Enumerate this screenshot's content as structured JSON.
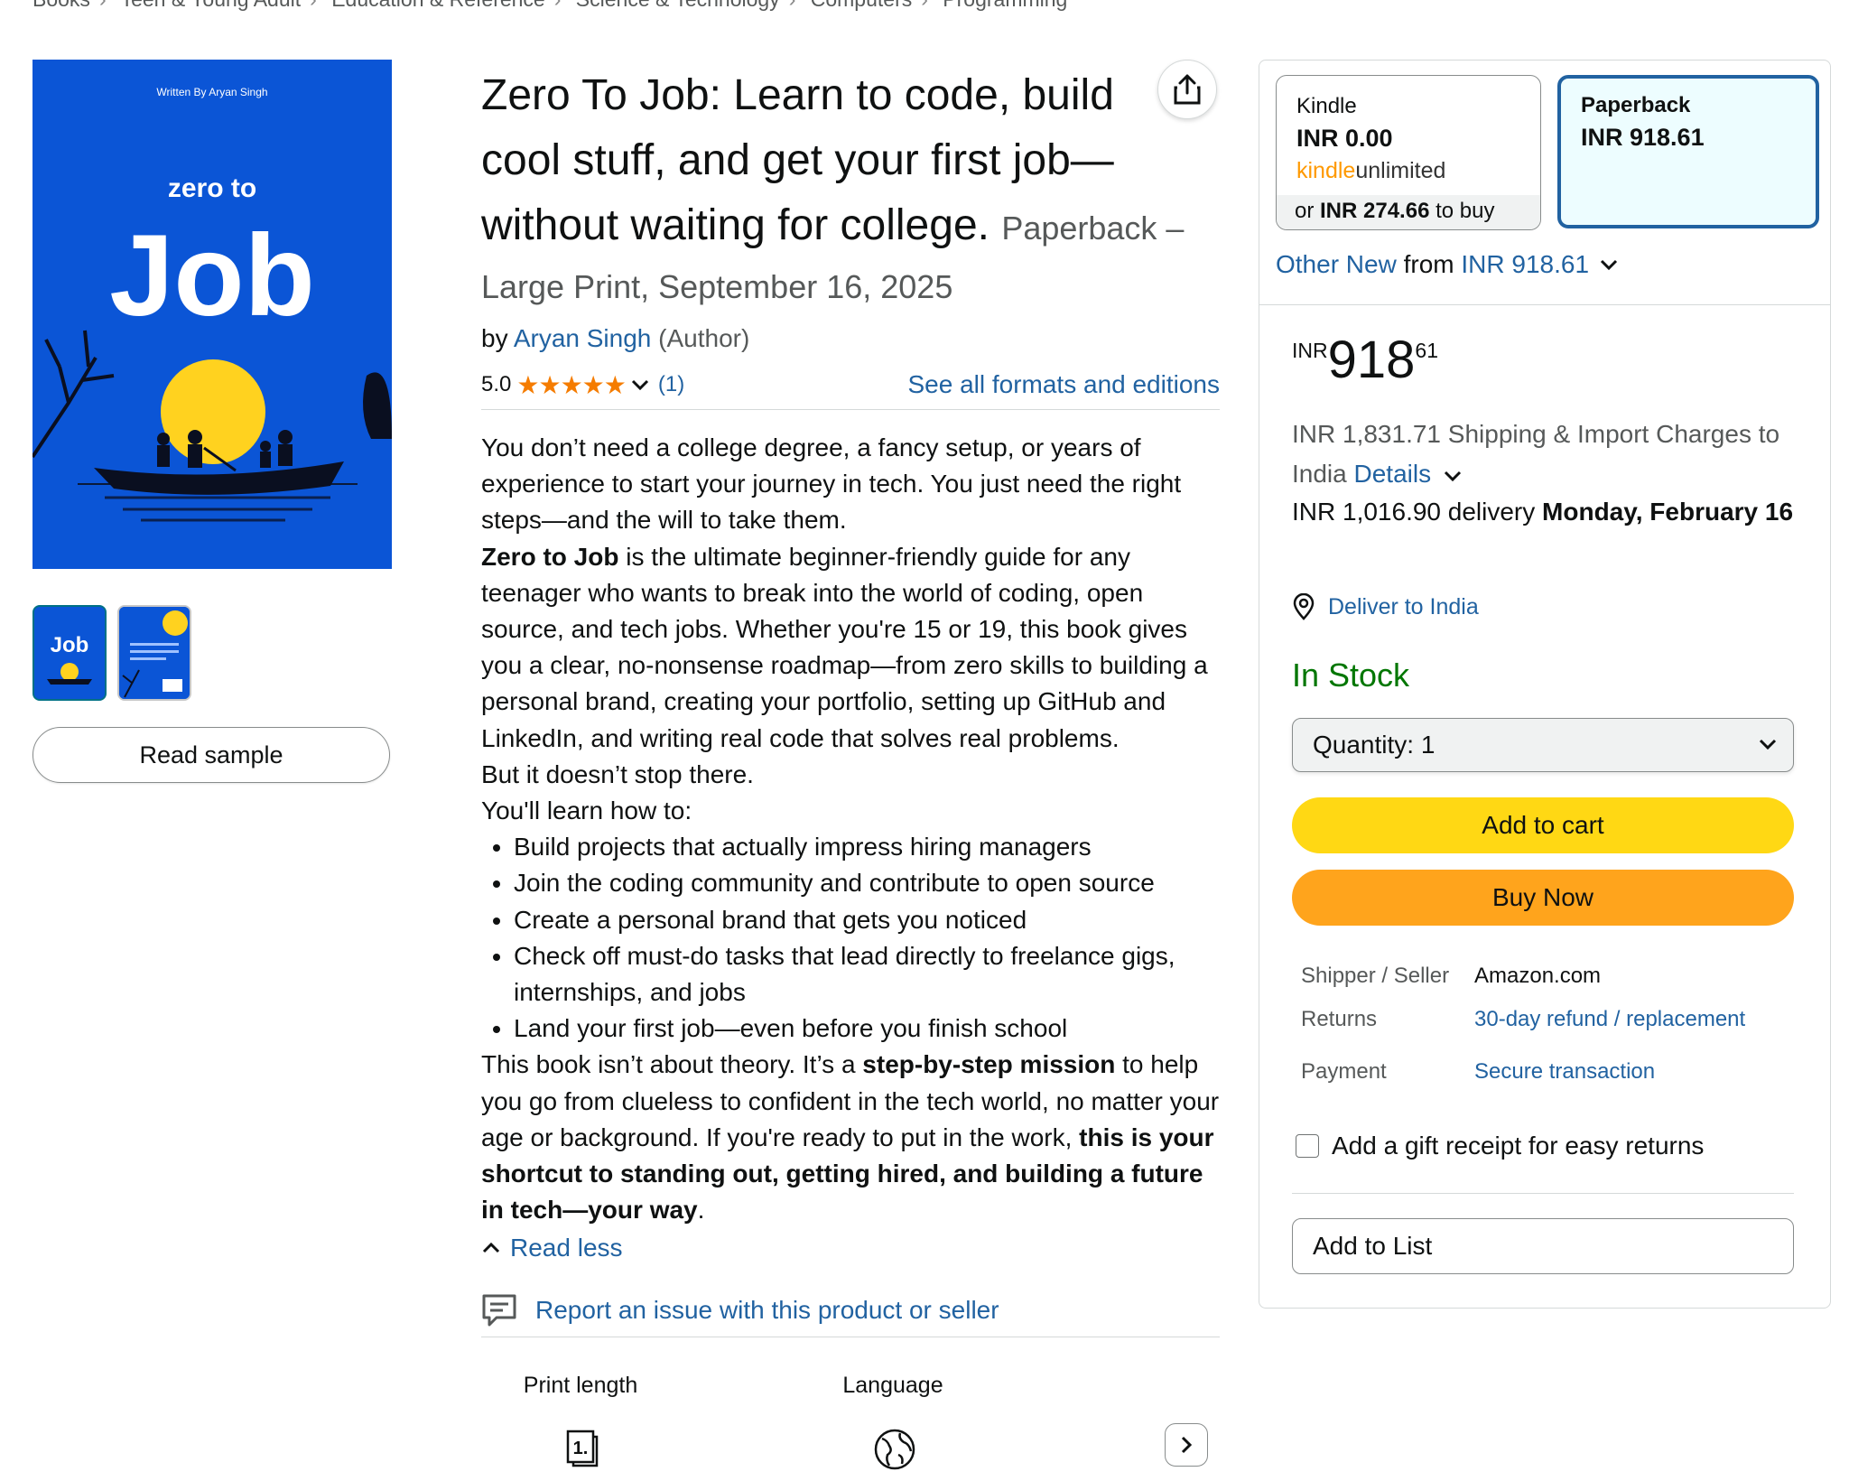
{
  "breadcrumb": [
    "Books",
    "Teen & Young Adult",
    "Education & Reference",
    "Science & Technology",
    "Computers",
    "Programming"
  ],
  "breadcrumb_sep": "›",
  "cover": {
    "written_by": "Written By Aryan Singh",
    "line1": "zero to",
    "line2": "Job"
  },
  "read_sample": "Read sample",
  "title": "Zero To Job: Learn to code, build cool stuff, and get your first job—without waiting for college.",
  "format_inline": "Paperback –",
  "format_line2": "Large Print, September 16, 2025",
  "byline": {
    "by": "by",
    "author": "Aryan Singh",
    "role": "(Author)"
  },
  "rating": {
    "value": "5.0",
    "stars": "★★★★★",
    "count": "(1)",
    "stars_level": 5.0
  },
  "see_all_formats": "See all formats and editions",
  "description": {
    "p1": "You don’t need a college degree, a fancy setup, or years of experience to start your journey in tech. You just need the right steps—and the will to take them.",
    "p2_bold": "Zero to Job",
    "p2_rest": " is the ultimate beginner-friendly guide for any teenager who wants to break into the world of coding, open source, and tech jobs. Whether you're 15 or 19, this book gives you a clear, no-nonsense roadmap—from zero skills to building a personal brand, creating your portfolio, setting up GitHub and LinkedIn, and writing real code that solves real problems.",
    "p3": "But it doesn’t stop there.",
    "p4": "You'll learn how to:",
    "bullets": [
      "Build projects that actually impress hiring managers",
      "Join the coding community and contribute to open source",
      "Create a personal brand that gets you noticed",
      "Check off must-do tasks that lead directly to freelance gigs, internships, and jobs",
      "Land your first job—even before you finish school"
    ],
    "p5_a": "This book isn’t about theory. It’s a ",
    "p5_b": "step-by-step mission",
    "p5_c": " to help you go from clueless to confident in the tech world, no matter your age or background. If you're ready to put in the work, ",
    "p5_d": "this is your shortcut to standing out, getting hired, and building a future in tech—your way",
    "p5_e": "."
  },
  "read_less": "Read less",
  "report": "Report an issue with this product or seller",
  "specs": [
    {
      "label": "Print length",
      "icon": "print-length-icon"
    },
    {
      "label": "Language",
      "icon": "globe-icon"
    }
  ],
  "buybox": {
    "kindle": {
      "name": "Kindle",
      "price": "INR 0.00",
      "ku_a": "kindle",
      "ku_b": "unlimited",
      "foot_a": "or ",
      "foot_b": "INR 274.66",
      "foot_c": " to buy"
    },
    "paperback": {
      "name": "Paperback",
      "price": "INR 918.61"
    },
    "other_new_a": "Other New",
    "other_new_b": " from ",
    "other_new_c": "INR 918.61",
    "price": {
      "currency": "INR",
      "whole": "918",
      "fraction": "61"
    },
    "shipping": "INR 1,831.71 Shipping & Import Charges to India",
    "details": "Details",
    "delivery_a": "INR 1,016.90 delivery ",
    "delivery_b": "Monday, February 16",
    "deliver_to": "Deliver to India",
    "stock": "In Stock",
    "quantity": "Quantity:  1",
    "add_to_cart": "Add to cart",
    "buy_now": "Buy Now",
    "info": [
      {
        "label": "Shipper / Seller",
        "value": "Amazon.com",
        "link": false
      },
      {
        "label": "Returns",
        "value": "30-day refund / replacement",
        "link": true
      },
      {
        "label": "Payment",
        "value": "Secure transaction",
        "link": true
      }
    ],
    "gift": "Add a gift receipt for easy returns",
    "add_to_list": "Add to List"
  },
  "colors": {
    "link": "#2162a1",
    "stock": "#007600",
    "cart": "#ffd814",
    "buy": "#ffa41c",
    "star": "#f57c00",
    "cover_bg": "#0b55d6"
  }
}
